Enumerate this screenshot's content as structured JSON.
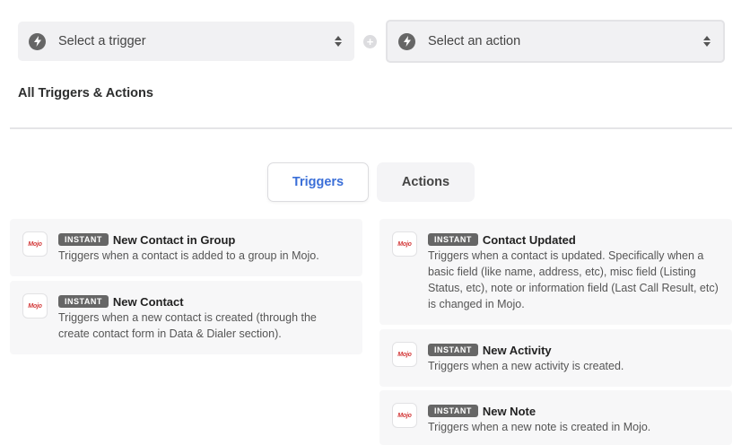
{
  "trigger_select": {
    "placeholder": "Select a trigger"
  },
  "action_select": {
    "placeholder": "Select an action"
  },
  "section_title": "All Triggers & Actions",
  "tabs": {
    "triggers": "Triggers",
    "actions": "Actions"
  },
  "logo_text": "Mojo",
  "left_cards": [
    {
      "badge": "INSTANT",
      "name": "New Contact in Group",
      "desc": "Triggers when a contact is added to a group in Mojo."
    },
    {
      "badge": "INSTANT",
      "name": "New Contact",
      "desc": "Triggers when a new contact is created (through the create contact form in Data & Dialer section)."
    }
  ],
  "right_cards": [
    {
      "badge": "INSTANT",
      "name": "Contact Updated",
      "desc": "Triggers when a contact is updated. Specifically when a basic field (like name, address, etc), misc field (Listing Status, etc), note or information field (Last Call Result, etc) is changed in Mojo."
    },
    {
      "badge": "INSTANT",
      "name": "New Activity",
      "desc": "Triggers when a new activity is created."
    },
    {
      "badge": "INSTANT",
      "name": "New Note",
      "desc": "Triggers when a new note is created in Mojo."
    }
  ]
}
